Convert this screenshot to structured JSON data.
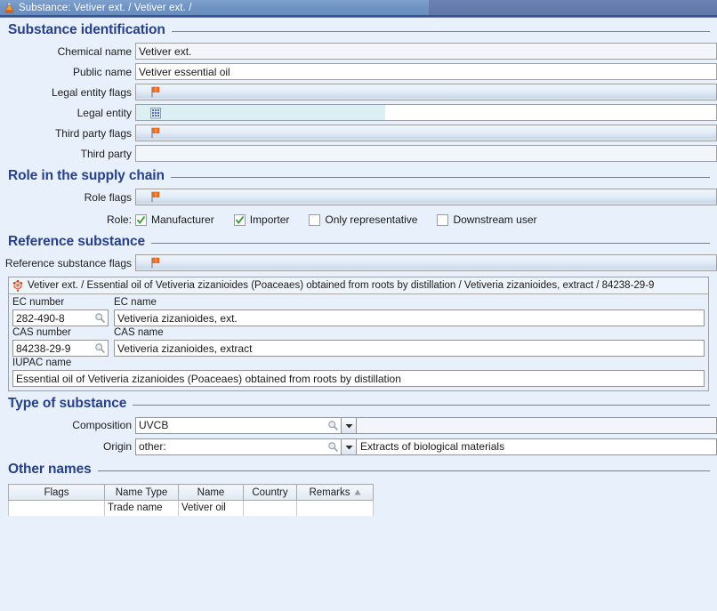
{
  "window": {
    "title": "Substance: Vetiver ext. / Vetiver ext. /",
    "icon": "flask-icon"
  },
  "colors": {
    "page_background": "#e8f1fb",
    "heading": "#27408b",
    "titlebar_left": "#6f92c4",
    "titlebar_right": "#657bac",
    "flag_accent": "#f07020",
    "checkmark": "#2e9b2e",
    "legal_entity_field": "#dcf0f3"
  },
  "sections": {
    "substance_identification": {
      "title": "Substance identification",
      "fields": [
        {
          "label": "Chemical name",
          "value": "Vetiver ext.",
          "type": "text-readonly"
        },
        {
          "label": "Public name",
          "value": "Vetiver essential oil",
          "type": "text"
        },
        {
          "label": "Legal entity flags",
          "value": "",
          "type": "flag",
          "icon": "flag-icon"
        },
        {
          "label": "Legal entity",
          "value": "",
          "type": "entity",
          "icon": "building-icon"
        },
        {
          "label": "Third party flags",
          "value": "",
          "type": "flag",
          "icon": "flag-icon"
        },
        {
          "label": "Third party",
          "value": "",
          "type": "text-readonly"
        }
      ]
    },
    "role_in_supply_chain": {
      "title": "Role in the supply chain",
      "role_flags_label": "Role flags",
      "role_flags_icon": "flag-icon",
      "role_label": "Role:",
      "checkboxes": [
        {
          "label": "Manufacturer",
          "checked": true
        },
        {
          "label": "Importer",
          "checked": true
        },
        {
          "label": "Only representative",
          "checked": false
        },
        {
          "label": "Downstream user",
          "checked": false
        }
      ]
    },
    "reference_substance": {
      "title": "Reference substance",
      "flags_label": "Reference substance flags",
      "flags_icon": "flag-icon",
      "header_icon": "molecule-icon",
      "header_text": "Vetiver ext. / Essential oil of Vetiveria zizanioides (Poaceaes) obtained from roots by distillation / Vetiveria zizanioides, extract / 84238-29-9",
      "ec_number_label": "EC number",
      "ec_number_value": "282-490-8",
      "ec_name_label": "EC name",
      "ec_name_value": "Vetiveria zizanioides, ext.",
      "cas_number_label": "CAS number",
      "cas_number_value": "84238-29-9",
      "cas_name_label": "CAS name",
      "cas_name_value": "Vetiveria zizanioides, extract",
      "iupac_name_label": "IUPAC name",
      "iupac_name_value": "Essential oil of Vetiveria zizanioides (Poaceaes) obtained from roots by distillation",
      "search_icon": "magnifier-icon"
    },
    "type_of_substance": {
      "title": "Type of substance",
      "rows": [
        {
          "label": "Composition",
          "value": "UVCB",
          "detail": "",
          "search_icon": "magnifier-icon",
          "dropdown_icon": "chevron-down-icon"
        },
        {
          "label": "Origin",
          "value": "other:",
          "detail": "Extracts of biological materials",
          "search_icon": "magnifier-icon",
          "dropdown_icon": "chevron-down-icon"
        }
      ]
    },
    "other_names": {
      "title": "Other names",
      "columns": [
        "Flags",
        "Name Type",
        "Name",
        "Country",
        "Remarks"
      ],
      "sorted_column": "Remarks",
      "sort_direction": "ascending",
      "sort_icon": "sort-ascending-icon",
      "rows": [
        {
          "flags": "",
          "name_type": "Trade name",
          "name": "Vetiver oil",
          "country": "",
          "remarks": ""
        }
      ]
    }
  }
}
